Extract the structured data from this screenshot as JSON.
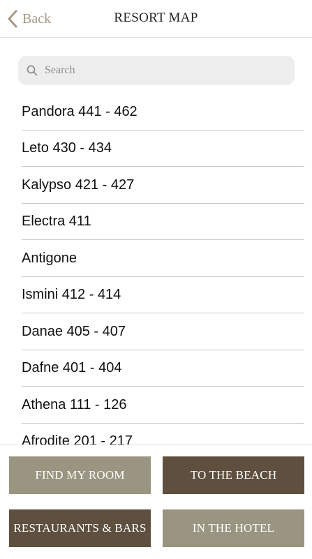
{
  "nav": {
    "back_label": "Back",
    "title": "RESORT MAP"
  },
  "search": {
    "placeholder": "Search"
  },
  "rooms": [
    "Pandora 441 - 462",
    "Leto 430 - 434",
    "Kalypso 421 - 427",
    "Electra 411",
    "Antigone",
    "Ismini 412 - 414",
    "Danae 405 - 407",
    "Dafne 401 - 404",
    "Athena 111 - 126",
    "Afrodite 201 - 217"
  ],
  "footer": {
    "find_my_room": "FIND MY ROOM",
    "to_the_beach": "TO THE BEACH",
    "restaurants_bars": "RESTAURANTS & BARS",
    "in_the_hotel": "IN THE HOTEL"
  },
  "colors": {
    "accent": "#a59a86",
    "button_light": "#9a9580",
    "button_dark": "#5f4f3e"
  }
}
